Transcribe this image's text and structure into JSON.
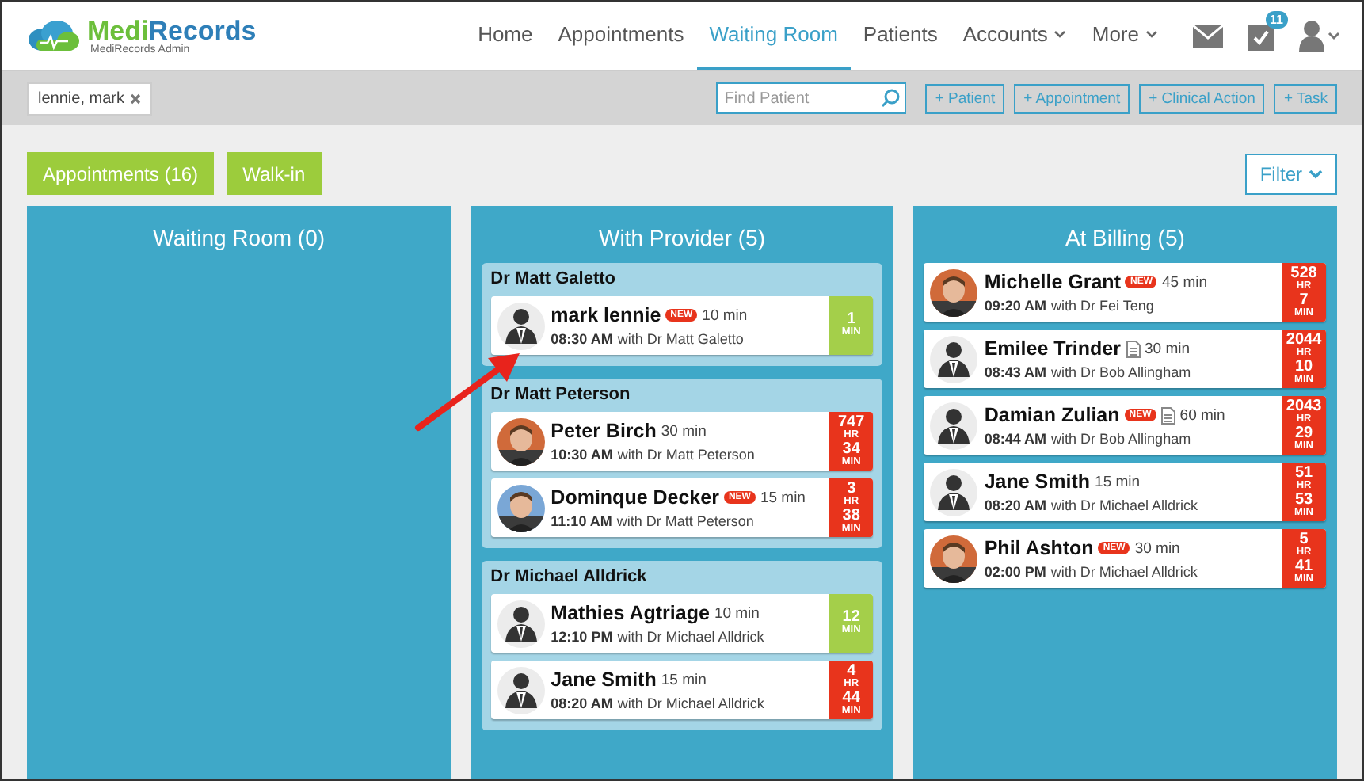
{
  "brand": {
    "name_a": "Medi",
    "name_b": "Records",
    "subtitle": "MediRecords Admin"
  },
  "nav": [
    {
      "label": "Home",
      "selected": false,
      "dropdown": false
    },
    {
      "label": "Appointments",
      "selected": false,
      "dropdown": false
    },
    {
      "label": "Waiting Room",
      "selected": true,
      "dropdown": false
    },
    {
      "label": "Patients",
      "selected": false,
      "dropdown": false
    },
    {
      "label": "Accounts",
      "selected": false,
      "dropdown": true
    },
    {
      "label": "More",
      "selected": false,
      "dropdown": true
    }
  ],
  "tasks_badge": "11",
  "toolbar": {
    "patient_chip": "lennie, mark",
    "search": {
      "placeholder": "Find Patient"
    },
    "actions": [
      "+ Patient",
      "+ Appointment",
      "+ Clinical Action",
      "+ Task"
    ]
  },
  "views": [
    {
      "label": "Appointments (16)"
    },
    {
      "label": "Walk-in"
    }
  ],
  "filter": "Filter",
  "columns": [
    {
      "title": "Waiting Room (0)"
    },
    {
      "title": "With Provider (5)",
      "groups": [
        {
          "provider": "Dr Matt Galetto",
          "cards": [
            {
              "avatar": {
                "kind": "default"
              },
              "name": "mark lennie",
              "badge": "NEW",
              "note": false,
              "duration": "10 min",
              "time": "08:30 AM",
              "with": "with Dr Matt Galetto",
              "timer": {
                "kind": "ok",
                "parts": [
                  {
                    "value": "1",
                    "unit": "MIN"
                  }
                ]
              }
            }
          ]
        },
        {
          "provider": "Dr Matt Peterson",
          "cards": [
            {
              "name": "Peter Birch",
              "note": false,
              "duration": "30 min",
              "time": "10:30 AM",
              "with": "with Dr Matt Peterson",
              "timer": {
                "kind": "late",
                "parts": [
                  {
                    "value": "747",
                    "unit": "HR"
                  },
                  {
                    "value": "34",
                    "unit": "MIN"
                  }
                ]
              }
            },
            {
              "name": "Dominque Decker",
              "badge": "NEW",
              "note": false,
              "duration": "15 min",
              "time": "11:10 AM",
              "with": "with Dr Matt Peterson",
              "timer": {
                "kind": "late",
                "parts": [
                  {
                    "value": "3",
                    "unit": "HR"
                  },
                  {
                    "value": "38",
                    "unit": "MIN"
                  }
                ]
              }
            }
          ]
        },
        {
          "provider": "Dr Michael Alldrick",
          "cards": [
            {
              "avatar": {
                "kind": "default"
              },
              "name": "Mathies Agtriage",
              "note": false,
              "duration": "10 min",
              "time": "12:10 PM",
              "with": "with Dr Michael Alldrick",
              "timer": {
                "kind": "ok",
                "parts": [
                  {
                    "value": "12",
                    "unit": "MIN"
                  }
                ]
              }
            },
            {
              "avatar": {
                "kind": "default"
              },
              "name": "Jane Smith",
              "note": false,
              "duration": "15 min",
              "time": "08:20 AM",
              "with": "with Dr Michael Alldrick",
              "timer": {
                "kind": "late",
                "parts": [
                  {
                    "value": "4",
                    "unit": "HR"
                  },
                  {
                    "value": "44",
                    "unit": "MIN"
                  }
                ]
              }
            }
          ]
        }
      ]
    },
    {
      "title": "At Billing (5)",
      "groups": [
        {
          "cards": [
            {
              "name": "Michelle Grant",
              "badge": "NEW",
              "note": false,
              "duration": "45 min",
              "time": "09:20 AM",
              "with": "with Dr Fei Teng",
              "timer": {
                "kind": "late",
                "parts": [
                  {
                    "value": "528",
                    "unit": "HR"
                  },
                  {
                    "value": "7",
                    "unit": "MIN"
                  }
                ]
              }
            },
            {
              "avatar": {
                "kind": "default"
              },
              "name": "Emilee Trinder",
              "note": true,
              "duration": "30 min",
              "time": "08:43 AM",
              "with": "with Dr Bob Allingham",
              "timer": {
                "kind": "late",
                "parts": [
                  {
                    "value": "2044",
                    "unit": "HR"
                  },
                  {
                    "value": "10",
                    "unit": "MIN"
                  }
                ]
              }
            },
            {
              "avatar": {
                "kind": "default"
              },
              "name": "Damian Zulian",
              "badge": "NEW",
              "note": true,
              "duration": "60 min",
              "time": "08:44 AM",
              "with": "with Dr Bob Allingham",
              "timer": {
                "kind": "late",
                "parts": [
                  {
                    "value": "2043",
                    "unit": "HR"
                  },
                  {
                    "value": "29",
                    "unit": "MIN"
                  }
                ]
              }
            },
            {
              "avatar": {
                "kind": "default"
              },
              "name": "Jane Smith",
              "note": false,
              "duration": "15 min",
              "time": "08:20 AM",
              "with": "with Dr Michael Alldrick",
              "timer": {
                "kind": "late",
                "parts": [
                  {
                    "value": "51",
                    "unit": "HR"
                  },
                  {
                    "value": "53",
                    "unit": "MIN"
                  }
                ]
              }
            },
            {
              "name": "Phil Ashton",
              "badge": "NEW",
              "note": false,
              "duration": "30 min",
              "time": "02:00 PM",
              "with": "with Dr Michael Alldrick",
              "timer": {
                "kind": "late",
                "parts": [
                  {
                    "value": "5",
                    "unit": "HR"
                  },
                  {
                    "value": "41",
                    "unit": "MIN"
                  }
                ]
              }
            }
          ]
        }
      ]
    }
  ]
}
